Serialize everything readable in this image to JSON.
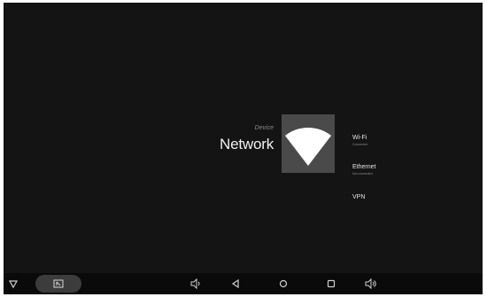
{
  "header": {
    "breadcrumb": "Device",
    "title": "Network"
  },
  "icon": "wifi-icon",
  "menu": {
    "items": [
      {
        "label": "Wi-Fi",
        "sublabel": "Connected"
      },
      {
        "label": "Ethernet",
        "sublabel": "Not connected"
      },
      {
        "label": "VPN",
        "sublabel": ""
      }
    ]
  },
  "nav_bar": {
    "buttons": [
      "collapse-icon",
      "screenshot-icon",
      "volume-down-icon",
      "back-icon",
      "home-icon",
      "recents-icon",
      "volume-up-icon"
    ]
  },
  "colors": {
    "background": "#141414",
    "tile": "#4a4a4a",
    "text": "#f0f0f0",
    "muted": "#8a8a8a",
    "nav_bar": "#0a0a0a"
  }
}
